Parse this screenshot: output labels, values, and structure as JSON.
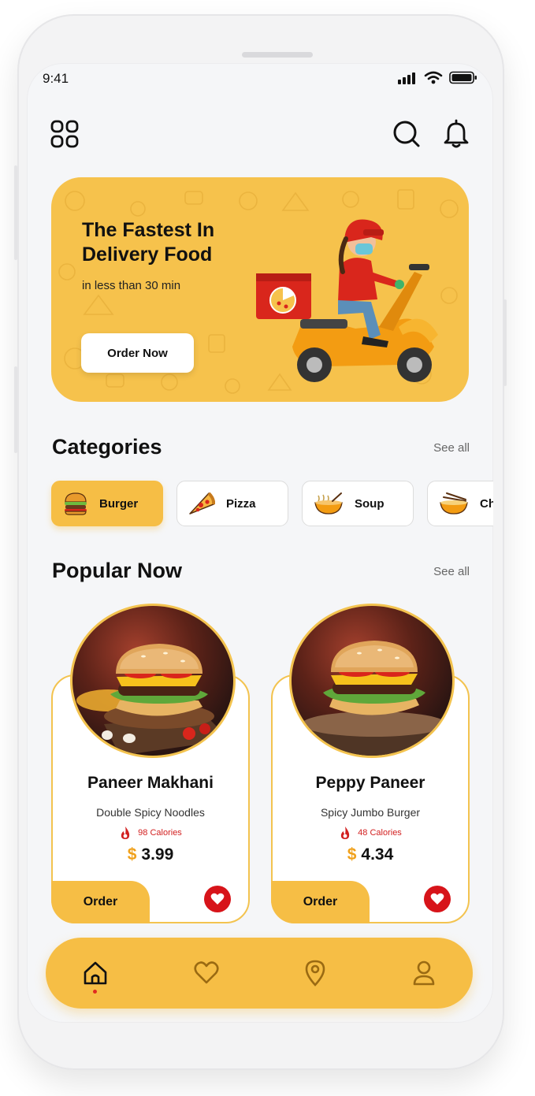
{
  "status_bar": {
    "time": "9:41"
  },
  "banner": {
    "title": "The Fastest In Delivery Food",
    "subtitle": "in less than 30 min",
    "button_label": "Order Now"
  },
  "categories": {
    "title": "Categories",
    "see_all": "See all",
    "items": [
      {
        "label": "Burger",
        "icon": "burger-icon",
        "active": true
      },
      {
        "label": "Pizza",
        "icon": "pizza-icon",
        "active": false
      },
      {
        "label": "Soup",
        "icon": "soup-icon",
        "active": false
      },
      {
        "label": "Ch",
        "icon": "noodles-icon",
        "active": false
      }
    ]
  },
  "popular": {
    "title": "Popular Now",
    "see_all": "See all",
    "items": [
      {
        "name": "Paneer Makhani",
        "description": "Double Spicy Noodles",
        "calories": "98 Calories",
        "currency": "$",
        "price": "3.99",
        "order_label": "Order"
      },
      {
        "name": "Peppy Paneer",
        "description": "Spicy Jumbo Burger",
        "calories": "48 Calories",
        "currency": "$",
        "price": "4.34",
        "order_label": "Order"
      }
    ]
  },
  "bottom_nav": {
    "items": [
      "home-icon",
      "heart-icon",
      "location-icon",
      "profile-icon"
    ],
    "active": "home-icon"
  },
  "colors": {
    "accent": "#f6be45",
    "banner": "#f6c24c",
    "heart": "#d7141a",
    "calorie": "#d21f1f"
  }
}
